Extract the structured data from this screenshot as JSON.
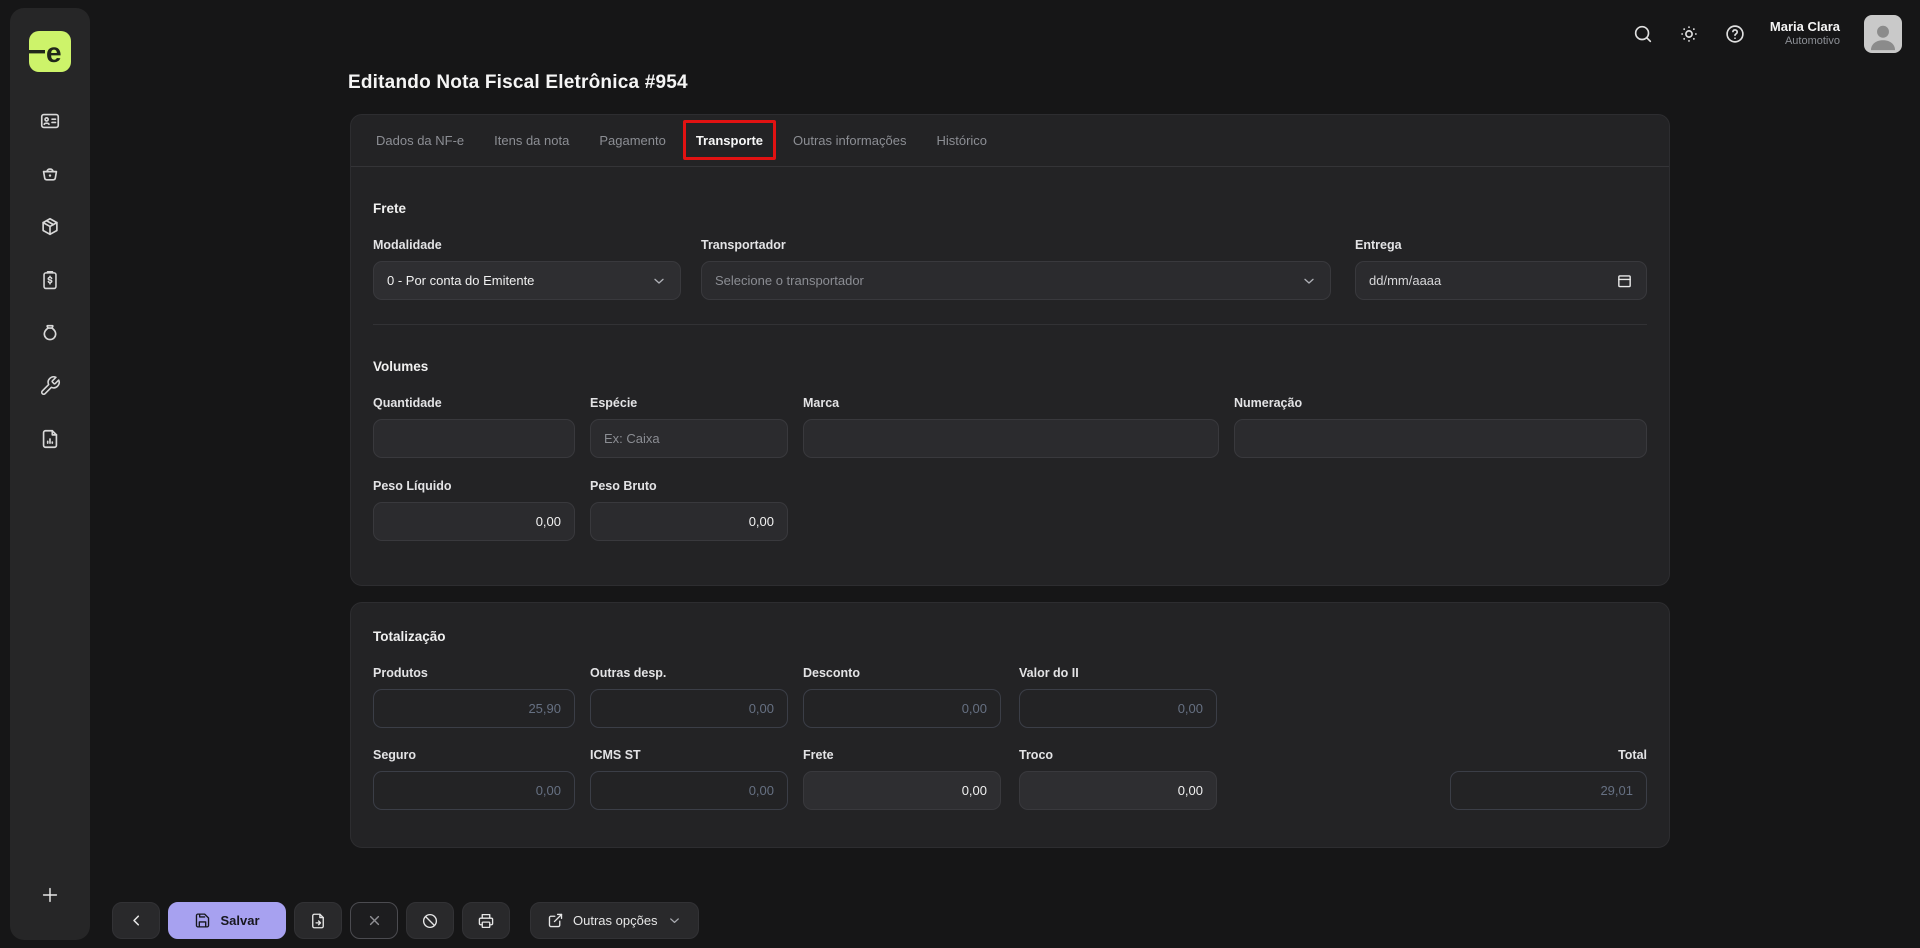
{
  "colors": {
    "accent": "#a7a1f0",
    "logo_bg": "#cdf36a",
    "annotation_red": "#e11212",
    "card_bg": "#232325",
    "page_bg": "#161617"
  },
  "topbar": {
    "icons": [
      "search-icon",
      "brightness-icon",
      "help-icon"
    ],
    "user": {
      "name": "Maria Clara",
      "role": "Automotivo"
    }
  },
  "sidebar": {
    "logo_letter": "e",
    "items": [
      "dashboard",
      "sales",
      "products",
      "billing",
      "finance",
      "tools",
      "reports"
    ],
    "add_label": "+"
  },
  "page_title": "Editando Nota Fiscal Eletrônica #954",
  "tabs": [
    {
      "label": "Dados da NF-e",
      "active": false
    },
    {
      "label": "Itens da nota",
      "active": false
    },
    {
      "label": "Pagamento",
      "active": false
    },
    {
      "label": "Transporte",
      "active": true,
      "annotated": true
    },
    {
      "label": "Outras informações",
      "active": false
    },
    {
      "label": "Histórico",
      "active": false
    }
  ],
  "freight": {
    "heading": "Frete",
    "modalidade": {
      "label": "Modalidade",
      "value": "0 - Por conta do Emitente"
    },
    "transportador": {
      "label": "Transportador",
      "placeholder": "Selecione o transportador"
    },
    "entrega": {
      "label": "Entrega",
      "display": "dd/mm/aaaa"
    }
  },
  "volumes": {
    "heading": "Volumes",
    "quantidade": {
      "label": "Quantidade",
      "value": ""
    },
    "especie": {
      "label": "Espécie",
      "placeholder": "Ex: Caixa",
      "value": ""
    },
    "marca": {
      "label": "Marca",
      "value": ""
    },
    "numeracao": {
      "label": "Numeração",
      "value": ""
    },
    "peso_liquido": {
      "label": "Peso Líquido",
      "value": "0,00"
    },
    "peso_bruto": {
      "label": "Peso Bruto",
      "value": "0,00"
    }
  },
  "totals": {
    "heading": "Totalização",
    "produtos": {
      "label": "Produtos",
      "value": "25,90"
    },
    "outras_desp": {
      "label": "Outras desp.",
      "value": "0,00"
    },
    "desconto": {
      "label": "Desconto",
      "value": "0,00"
    },
    "valor_ii": {
      "label": "Valor do II",
      "value": "0,00"
    },
    "seguro": {
      "label": "Seguro",
      "value": "0,00"
    },
    "icms_st": {
      "label": "ICMS ST",
      "value": "0,00"
    },
    "frete": {
      "label": "Frete",
      "value": "0,00"
    },
    "troco": {
      "label": "Troco",
      "value": "0,00"
    },
    "total": {
      "label": "Total",
      "value": "29,01"
    }
  },
  "footer": {
    "salvar_label": "Salvar",
    "outras_opcoes_label": "Outras opções",
    "icons": [
      "chevron-left-icon",
      "save-icon",
      "file-export-icon",
      "close-icon",
      "ban-icon",
      "printer-icon",
      "external-link-icon",
      "chevron-down-icon"
    ]
  }
}
